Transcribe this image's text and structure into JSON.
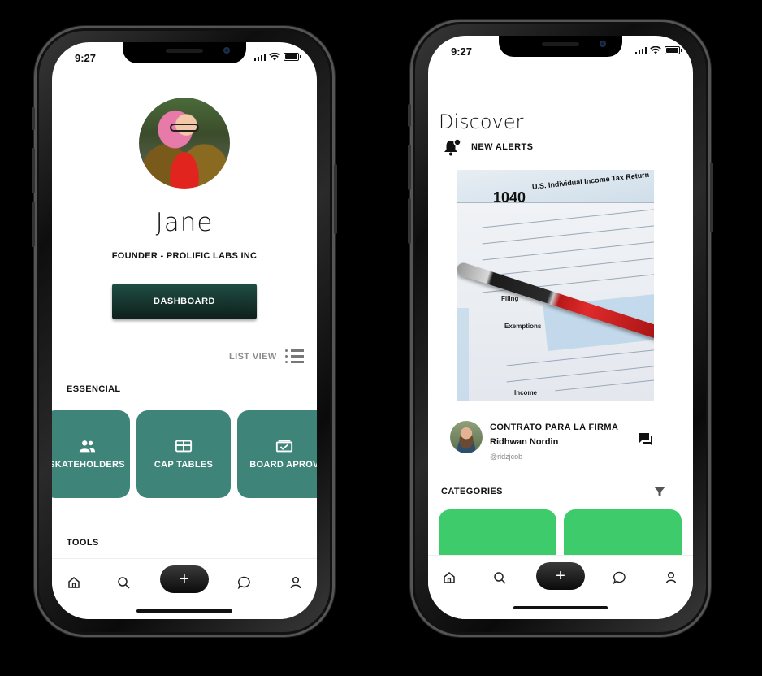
{
  "left_phone": {
    "status": {
      "time": "9:27"
    },
    "profile": {
      "name": "Jane",
      "role": "FOUNDER -  PROLIFIC LABS INC"
    },
    "dashboard_button": "DASHBOARD",
    "list_view_label": "LIST VIEW",
    "section_essencial": "ESSENCIAL",
    "cards": [
      {
        "label": "SKATEHOLDERS",
        "icon": "people-icon"
      },
      {
        "label": "CAP TABLES",
        "icon": "table-icon"
      },
      {
        "label": "BOARD APROV",
        "icon": "approval-icon"
      }
    ],
    "section_tools": "TOOLS",
    "accent": "#3f8479"
  },
  "right_phone": {
    "status": {
      "time": "9:27"
    },
    "title": "Discover",
    "alerts_label": "NEW ALERTS",
    "image": {
      "form_number": "1040",
      "form_title": "U.S. Individual Income Tax Return",
      "filing_label": "Filing",
      "exemptions_label": "Exemptions",
      "income_label": "Income"
    },
    "contract": {
      "title": "CONTRATO PARA LA FIRMA",
      "name": "Ridhwan Nordin",
      "handle": "@ridzjcob"
    },
    "categories_label": "CATEGORIES",
    "accent": "#3ecb6c"
  },
  "navbar": {
    "items": [
      "home-icon",
      "search-icon",
      "plus-button",
      "chat-icon",
      "user-icon"
    ],
    "plus_label": "+"
  }
}
